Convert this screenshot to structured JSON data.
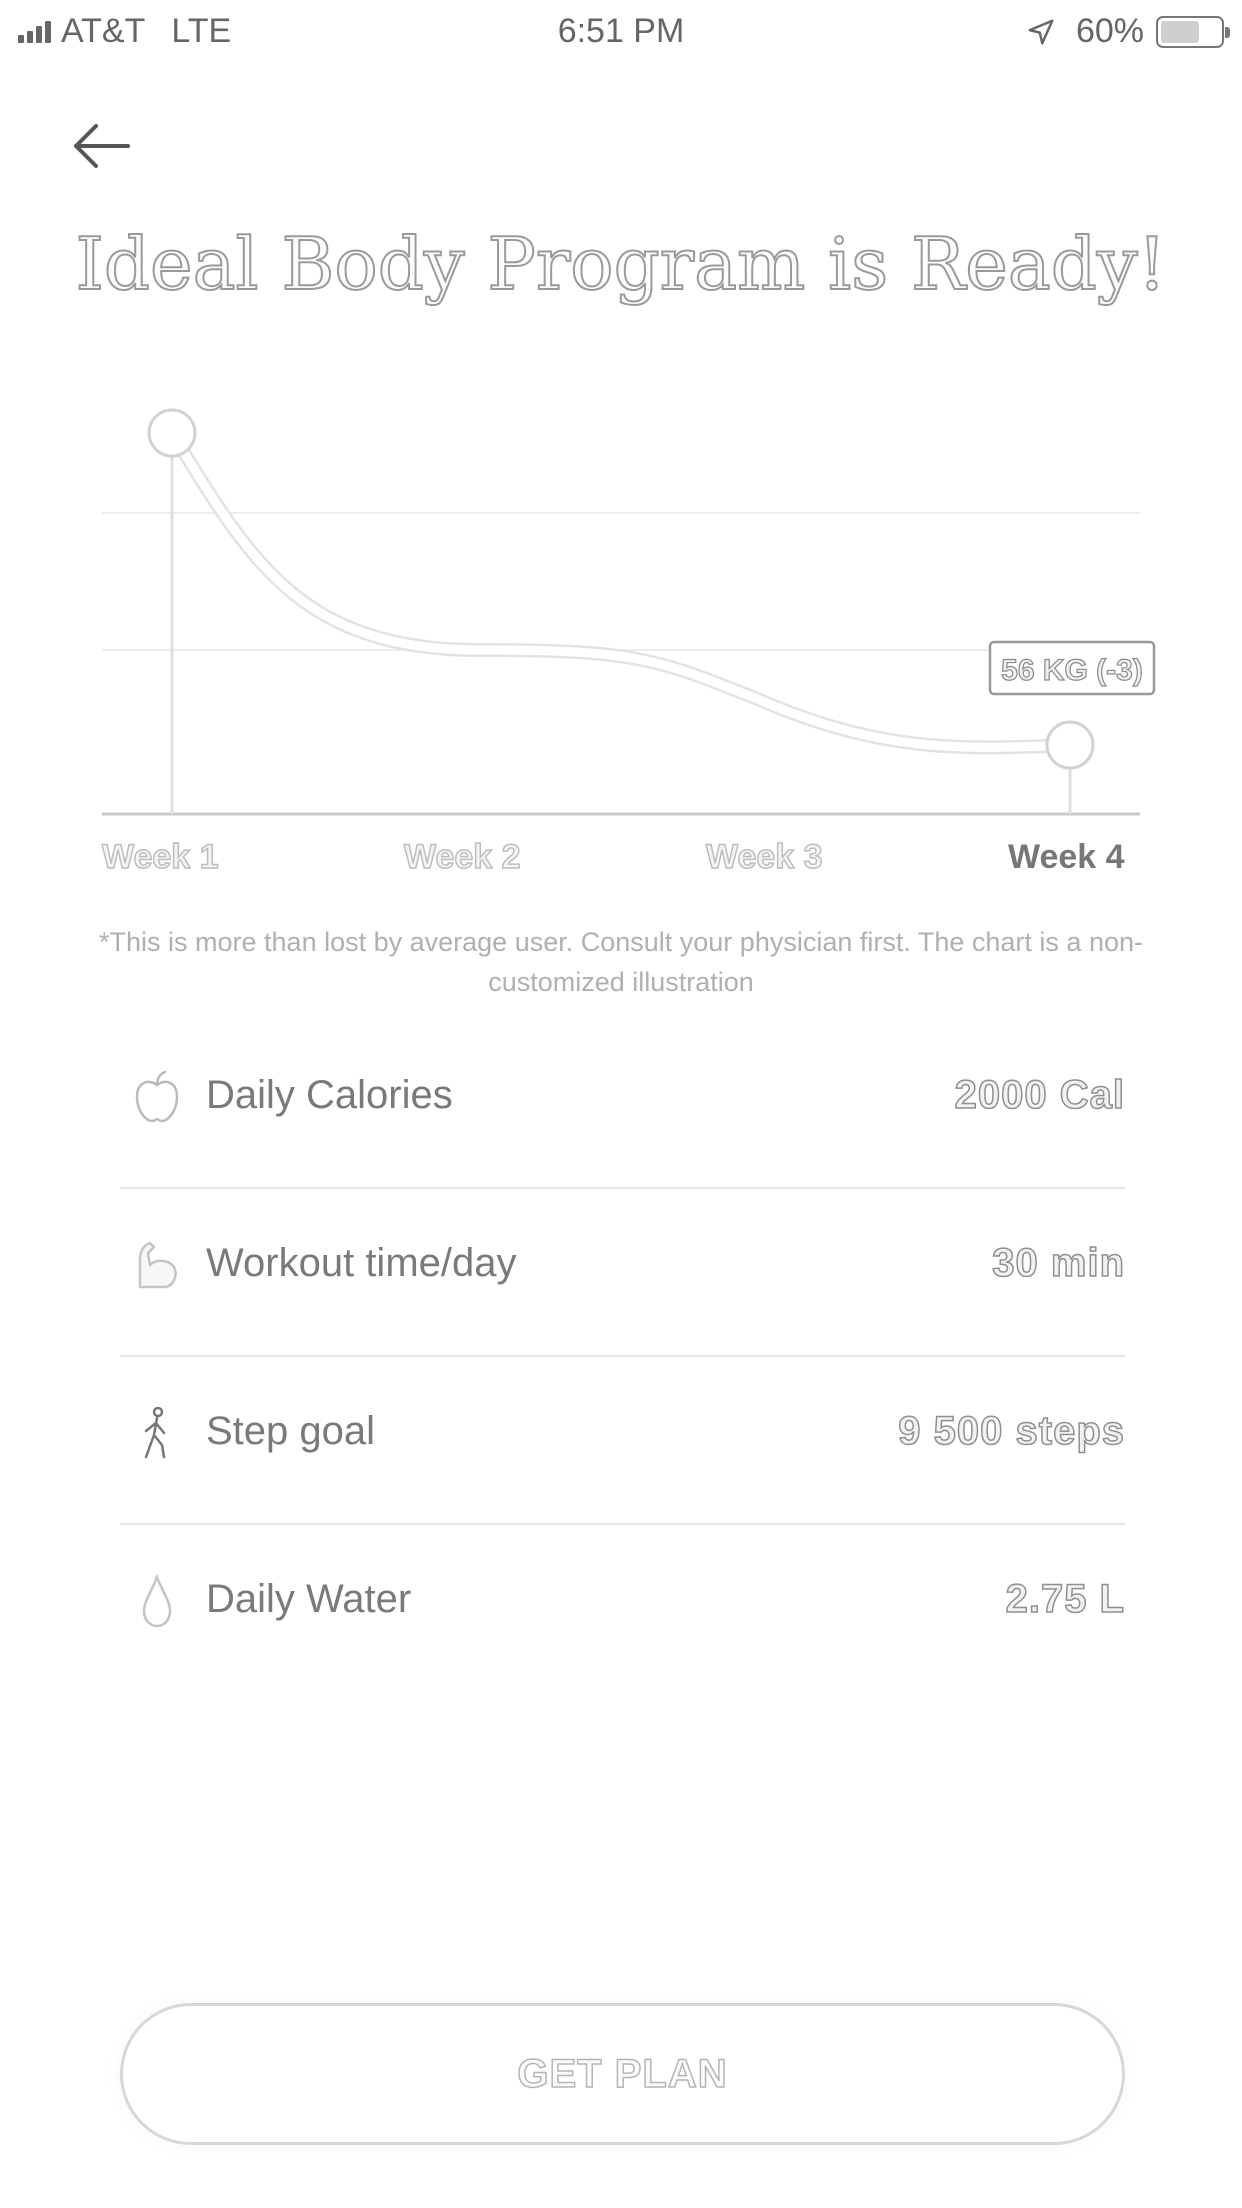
{
  "status_bar": {
    "carrier": "AT&T",
    "network": "LTE",
    "time": "6:51 PM",
    "battery": "60%",
    "icons": [
      "signal-icon",
      "location-arrow-icon",
      "battery-icon"
    ]
  },
  "nav": {
    "back_icon": "back-arrow-icon"
  },
  "title": "Ideal Body Program is Ready!",
  "chart_data": {
    "type": "line",
    "categories": [
      "Week 1",
      "Week 2",
      "Week 3",
      "Week 4"
    ],
    "series": [
      {
        "values": [
          59,
          57,
          57,
          56
        ]
      }
    ],
    "end_annotation": "56 KG (-3)",
    "active_category": "Week 4",
    "grid": true
  },
  "disclaimer": "*This is more than lost by average user. Consult your physician first. The chart is a non-customized illustration",
  "stats": [
    {
      "icon": "apple-icon",
      "label": "Daily Calories",
      "value": "2000 Cal"
    },
    {
      "icon": "flexed-bicep-icon",
      "label": "Workout time/day",
      "value": "30 min"
    },
    {
      "icon": "walking-person-icon",
      "label": "Step goal",
      "value": "9 500 steps"
    },
    {
      "icon": "water-drop-icon",
      "label": "Daily Water",
      "value": "2.75 L"
    }
  ],
  "cta": {
    "label": "GET PLAN"
  }
}
